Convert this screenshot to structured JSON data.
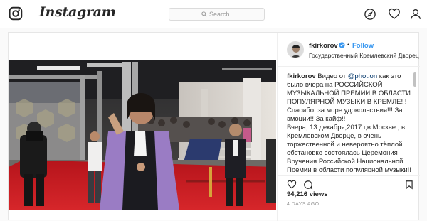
{
  "app": {
    "wordmark": "Instagram",
    "search_placeholder": "Search"
  },
  "nav_icons": [
    "explore-icon",
    "heart-icon",
    "profile-icon"
  ],
  "post": {
    "username": "fkirkorov",
    "dot": "•",
    "follow_label": "Follow",
    "location": "Государственный Кремлевский Дворец",
    "caption_username": "fkirkorov",
    "caption_before_mention": " Видео от ",
    "caption_mention": "@phot.on",
    "caption_after_mention": " как это было вчера на РОССИЙСКОЙ МУЗЫКАЛЬНОЙ ПРЕМИИ В ОБЛАСТИ ПОПУЛЯРНОЙ МУЗЫКИ В КРЕМЛЕ!!!",
    "caption_line2": "Спасибо, за море удовольствия!!! За эмоции!! За кайф!!",
    "caption_line3": "Вчера, 13 декабря,2017 г,в Москве , в Кремлевском Дворце, в очень торжественной и невероятно тёплой обстановке состоялась Церемония Вручения Российской Национальной Премии в области популярной музыки!!",
    "views": "94,216 views",
    "date": "4 DAYS AGO"
  },
  "colors": {
    "link_blue": "#3897f0",
    "verified_blue": "#3897f0",
    "border": "#dbdbdb"
  }
}
